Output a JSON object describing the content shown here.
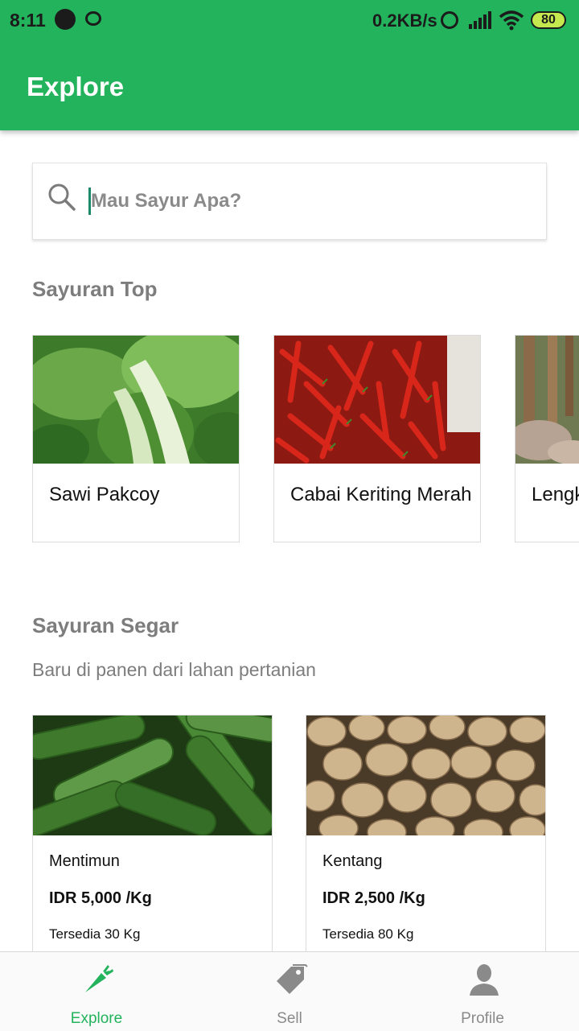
{
  "status_bar": {
    "time": "8:11",
    "net_speed": "0.2KB/s",
    "battery": "80"
  },
  "app_bar": {
    "title": "Explore",
    "color": "#22b35c"
  },
  "search": {
    "placeholder": "Mau Sayur Apa?",
    "value": ""
  },
  "sayuran_top": {
    "title": "Sayuran Top",
    "items": [
      {
        "name": "Sawi Pakcoy",
        "image": "pakcoy-photo"
      },
      {
        "name": "Cabai Keriting Merah",
        "image": "red-chili-photo"
      },
      {
        "name": "Lengk",
        "image": "lengkuas-photo"
      }
    ]
  },
  "sayuran_segar": {
    "title": "Sayuran Segar",
    "subtitle": "Baru di panen dari lahan pertanian",
    "items": [
      {
        "name": "Mentimun",
        "price": "IDR 5,000 /Kg",
        "stock": "Tersedia 30 Kg",
        "image": "cucumber-photo"
      },
      {
        "name": "Kentang",
        "price": "IDR 2,500 /Kg",
        "stock": "Tersedia 80 Kg",
        "image": "potato-photo"
      }
    ]
  },
  "bottom_nav": {
    "items": [
      {
        "label": "Explore",
        "icon": "carrot-icon",
        "active": true
      },
      {
        "label": "Sell",
        "icon": "tag-icon",
        "active": false
      },
      {
        "label": "Profile",
        "icon": "person-icon",
        "active": false
      }
    ],
    "active_color": "#22b35c",
    "inactive_color": "#8a8a8a"
  }
}
